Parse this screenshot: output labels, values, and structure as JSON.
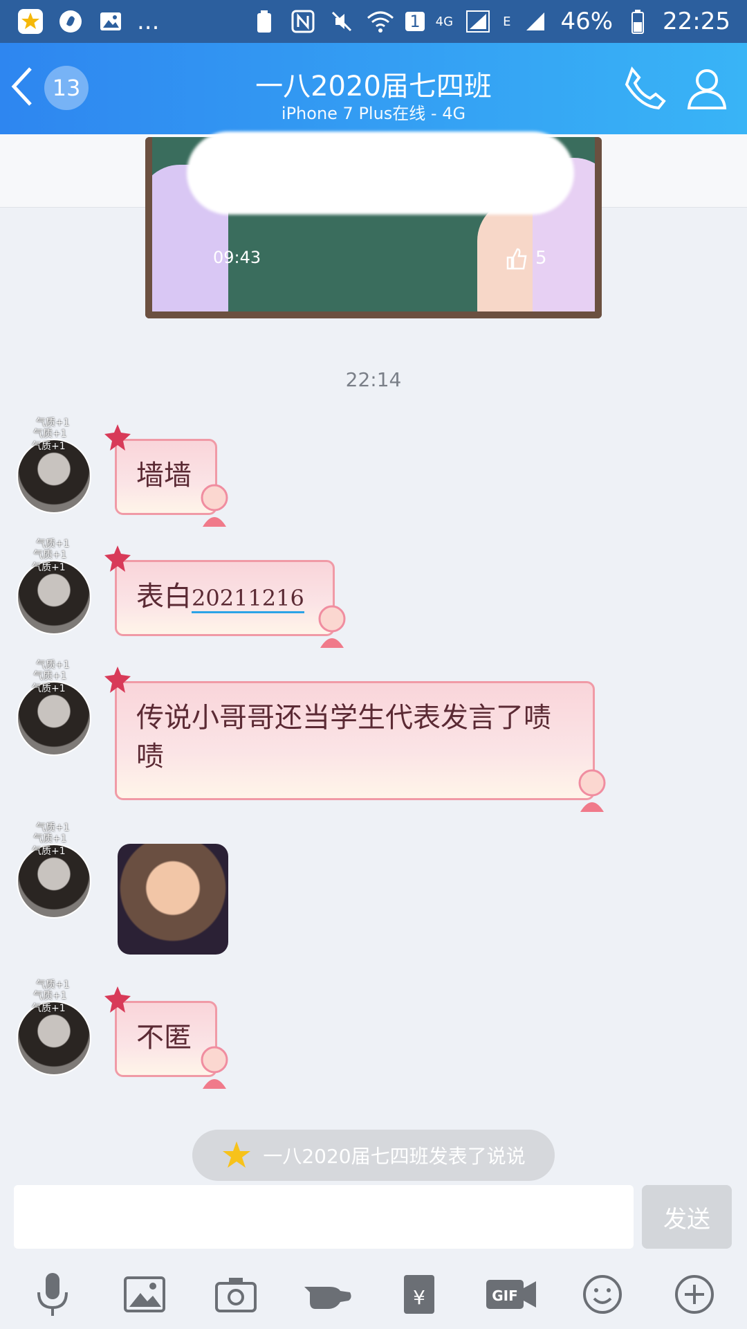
{
  "status_bar": {
    "left_more": "...",
    "sim_badge": "1",
    "net_label": "4G",
    "net_label2": "E",
    "battery": "46%",
    "time": "22:25"
  },
  "header": {
    "back_badge": "13",
    "title": "一八2020届七四班",
    "subtitle": "iPhone 7 Plus在线 - 4G"
  },
  "banner": {
    "time": "09:43",
    "likes": "5"
  },
  "chat": {
    "time_separator": "22:14",
    "avatar_tag": "气质+1",
    "messages": [
      {
        "type": "text",
        "text": "墙墙"
      },
      {
        "type": "text",
        "text_prefix": "表白",
        "text_highlight": "20211216"
      },
      {
        "type": "text",
        "text": "传说小哥哥还当学生代表发言了啧啧"
      },
      {
        "type": "sticker"
      },
      {
        "type": "text",
        "text": "不匿"
      }
    ]
  },
  "notification": {
    "text": "一八2020届七四班发表了说说"
  },
  "composer": {
    "input_value": "",
    "send_label": "发送"
  },
  "toolbar": {
    "items": [
      "microphone-icon",
      "image-icon",
      "camera-icon",
      "poke-icon",
      "red-envelope-icon",
      "gif-icon",
      "emoji-icon",
      "plus-icon"
    ],
    "gif_label": "GIF"
  },
  "colors": {
    "header_start": "#2e86f0",
    "header_end": "#39b4f6",
    "statusbar": "#2c5f9e",
    "bubble_border": "#f09aa6",
    "background": "#eef1f6"
  }
}
